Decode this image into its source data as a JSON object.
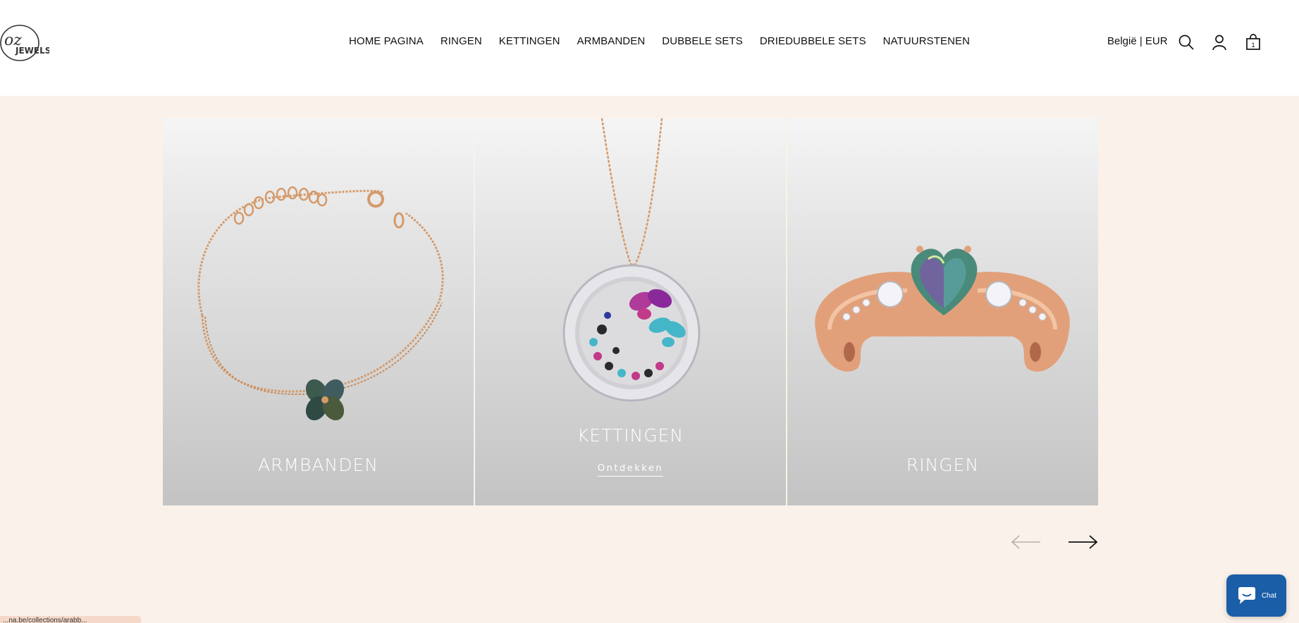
{
  "header": {
    "logo_text": "oz JEWELS",
    "nav": [
      {
        "label": "HOME PAGINA"
      },
      {
        "label": "RINGEN"
      },
      {
        "label": "KETTINGEN"
      },
      {
        "label": "ARMBANDEN"
      },
      {
        "label": "DUBBELE SETS"
      },
      {
        "label": "DRIEDUBBELE SETS"
      },
      {
        "label": "NATUURSTENEN"
      }
    ],
    "locale": "België | EUR",
    "icons": [
      "search-icon",
      "account-icon",
      "cart-icon"
    ],
    "cart_count": "1"
  },
  "carousel": {
    "cards": [
      {
        "title": "ARMBANDEN",
        "link": ""
      },
      {
        "title": "KETTINGEN",
        "link": "Ontdekken"
      },
      {
        "title": "RINGEN",
        "link": ""
      }
    ],
    "prev_icon": "arrow-left-icon",
    "next_icon": "arrow-right-icon"
  },
  "chat": {
    "label": "Chat"
  },
  "status_url": "...na.be/collections/arabb..."
}
